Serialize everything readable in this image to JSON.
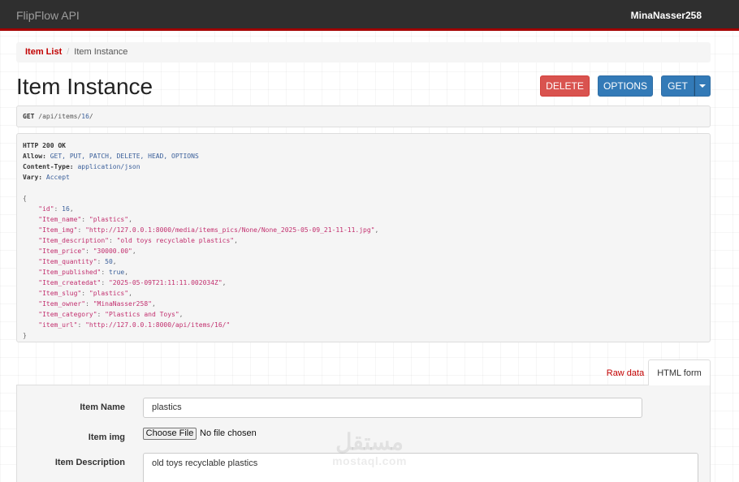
{
  "navbar": {
    "brand": "FlipFlow API",
    "user": "MinaNasser258"
  },
  "breadcrumb": {
    "items": [
      "Item List",
      "Item Instance"
    ],
    "separator": "/"
  },
  "page": {
    "title": "Item Instance"
  },
  "actions": {
    "delete_label": "DELETE",
    "options_label": "OPTIONS",
    "get_label": "GET"
  },
  "request": {
    "method": "GET",
    "path_prefix": "/api/items/",
    "path_id": "16",
    "path_suffix": "/"
  },
  "response": {
    "status": "HTTP 200 OK",
    "headers": [
      {
        "key": "Allow:",
        "value": "GET, PUT, PATCH, DELETE, HEAD, OPTIONS"
      },
      {
        "key": "Content-Type:",
        "value": "application/json"
      },
      {
        "key": "Vary:",
        "value": "Accept"
      }
    ],
    "open_brace": "{",
    "close_brace": "}",
    "body": [
      {
        "key": "\"id\"",
        "value": "16",
        "type": "num"
      },
      {
        "key": "\"Item_name\"",
        "value": "\"plastics\"",
        "type": "str"
      },
      {
        "key": "\"Item_img\"",
        "value": "\"http://127.0.0.1:8000/media/items_pics/None/None_2025-05-09_21-11-11.jpg\"",
        "type": "str"
      },
      {
        "key": "\"Item_description\"",
        "value": "\"old toys recyclable plastics\"",
        "type": "str"
      },
      {
        "key": "\"Item_price\"",
        "value": "\"30000.00\"",
        "type": "str"
      },
      {
        "key": "\"Item_quantity\"",
        "value": "50",
        "type": "num"
      },
      {
        "key": "\"Item_published\"",
        "value": "true",
        "type": "lit"
      },
      {
        "key": "\"Item_createdat\"",
        "value": "\"2025-05-09T21:11:11.002034Z\"",
        "type": "str"
      },
      {
        "key": "\"Item_slug\"",
        "value": "\"plastics\"",
        "type": "str"
      },
      {
        "key": "\"Item_owner\"",
        "value": "\"MinaNasser258\"",
        "type": "str"
      },
      {
        "key": "\"Item_category\"",
        "value": "\"Plastics and Toys\"",
        "type": "str"
      },
      {
        "key": "\"item_url\"",
        "value": "\"http://127.0.0.1:8000/api/items/16/\"",
        "type": "str"
      }
    ]
  },
  "tabs": {
    "raw": "Raw data",
    "html": "HTML form"
  },
  "form": {
    "name_label": "Item Name",
    "name_value": "plastics",
    "img_label": "Item img",
    "file_button": "Choose File",
    "file_status": "No file chosen",
    "desc_label": "Item Description",
    "desc_value": "old toys recyclable plastics"
  },
  "watermark": {
    "arabic": "مستقل",
    "latin": "mostaql.com"
  },
  "colors": {
    "navbar": "#2f2f2f",
    "accent": "#c20000",
    "delete": "#d9534f",
    "primary": "#337ab7"
  }
}
